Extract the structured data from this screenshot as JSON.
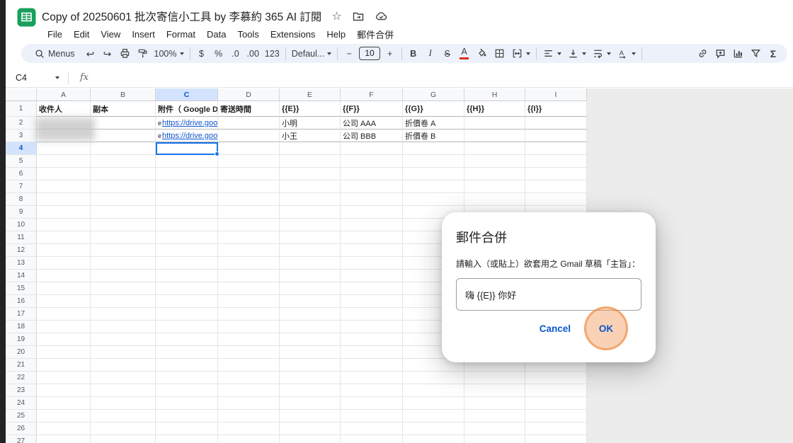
{
  "header": {
    "title": "Copy of 20250601 批次寄信小工具 by 李慕約 365 AI 訂閱",
    "menus": [
      "File",
      "Edit",
      "View",
      "Insert",
      "Format",
      "Data",
      "Tools",
      "Extensions",
      "Help",
      "郵件合併"
    ]
  },
  "toolbar": {
    "menus_label": "Menus",
    "zoom": "100%",
    "currency": "$",
    "percent": "%",
    "decrease_decimals": ".0",
    "increase_decimals": ".00",
    "number_format": "123",
    "font": "Defaul...",
    "decrease_font": "−",
    "font_size": "10",
    "increase_font": "+",
    "bold": "B",
    "italic": "I",
    "strikethrough": "S",
    "text_color": "A"
  },
  "formula_bar": {
    "name_box": "C4",
    "fx": "fx"
  },
  "grid": {
    "column_headers": [
      "A",
      "B",
      "C",
      "D",
      "E",
      "F",
      "G",
      "H",
      "I"
    ],
    "selected_column": "C",
    "selected_row": "4",
    "selected_cell": "C4",
    "last_row": 27,
    "row1": {
      "A": "收件人",
      "B": "副本",
      "C": "附件（ Google D",
      "D": "寄送時間",
      "E": "{{E}}",
      "F": "{{F}}",
      "G": "{{G}}",
      "H": "{{H}}",
      "I": "{{I}}"
    },
    "row2": {
      "C_prefix": "e",
      "C_link": "https://drive.goo",
      "E": "小明",
      "F": "公司 AAA",
      "G": "折價卷 A"
    },
    "row3": {
      "C_prefix": "e",
      "C_link": "https://drive.goo",
      "E": "小王",
      "F": "公司 BBB",
      "G": "折價卷 B"
    }
  },
  "dialog": {
    "title": "郵件合併",
    "prompt": "請輸入（或貼上）欲套用之 Gmail 草稿「主旨」：",
    "input_value": "嗨 {{E}} 你好",
    "cancel": "Cancel",
    "ok": "OK"
  },
  "icons": {
    "undo": "↩",
    "redo": "↪",
    "star": "☆",
    "functions": "Σ"
  },
  "colors": {
    "accent": "#1a73e8",
    "link_blue": "#1155cc",
    "selection_header_bg": "#d3e3fd",
    "toolbar_bg": "#edf2fa",
    "dialog_button": "#0b57d0",
    "click_halo": "#f08a3c",
    "sheets_green": "#18a05c"
  }
}
